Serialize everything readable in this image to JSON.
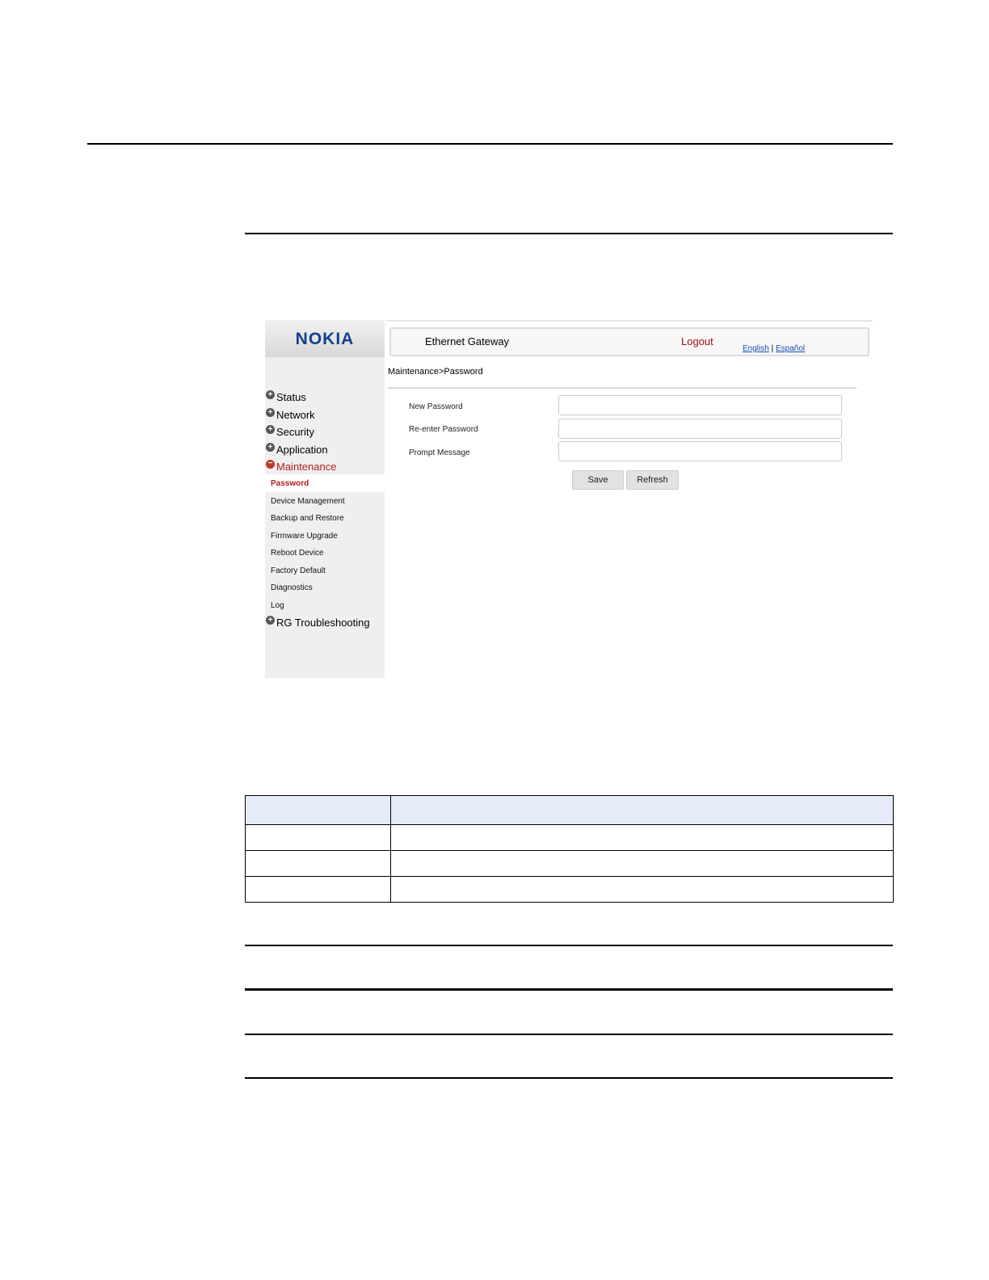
{
  "screenshot": {
    "logo": "NOKIA",
    "header": {
      "title": "Ethernet Gateway",
      "logout": "Logout",
      "lang_english": "English",
      "lang_separator": "|",
      "lang_espanol": "Español"
    },
    "breadcrumb": "Maintenance>Password",
    "sidebar": {
      "top_items": [
        {
          "label": "Status",
          "icon": "plus-icon"
        },
        {
          "label": "Network",
          "icon": "plus-icon"
        },
        {
          "label": "Security",
          "icon": "plus-icon"
        },
        {
          "label": "Application",
          "icon": "plus-icon"
        },
        {
          "label": "Maintenance",
          "icon": "minus-icon"
        }
      ],
      "sub_items": [
        "Password",
        "Device Management",
        "Backup and Restore",
        "Firmware Upgrade",
        "Reboot Device",
        "Factory Default",
        "Diagnostics",
        "Log"
      ],
      "bottom_item": {
        "label": "RG Troubleshooting",
        "icon": "plus-icon"
      }
    },
    "form": {
      "new_password_label": "New Password",
      "reenter_password_label": "Re-enter Password",
      "prompt_message_label": "Prompt Message",
      "new_password_value": "",
      "reenter_password_value": "",
      "prompt_message_value": "",
      "save_label": "Save",
      "refresh_label": "Refresh"
    },
    "colors": {
      "logo": "#124191",
      "active_nav": "#b41c1c",
      "link": "#1a50b5"
    }
  }
}
